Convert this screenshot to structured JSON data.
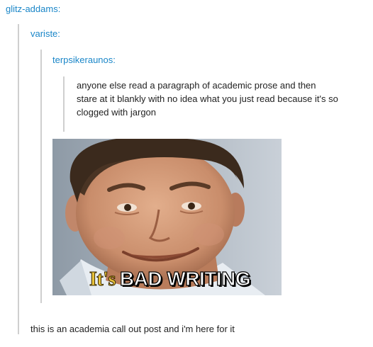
{
  "thread": {
    "user1": "glitz-addams:",
    "user2": "variste:",
    "user3": "terpsikeraunos:",
    "original_post": [
      "anyone else read a paragraph of academic prose and then",
      "stare at it blankly with no idea what you just read because it's so",
      "clogged with jargon"
    ],
    "gif": {
      "caption_prefix": "It's",
      "caption_main": "BAD WRITING"
    },
    "reply": "this is an academia call out post and i'm here for it"
  },
  "colors": {
    "username": "#1a86c8",
    "border": "#cfcfcf",
    "text": "#222222"
  }
}
